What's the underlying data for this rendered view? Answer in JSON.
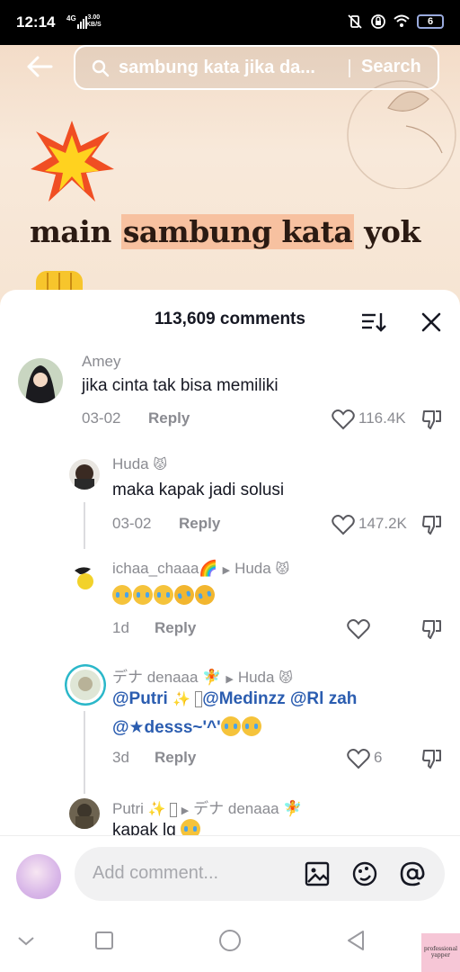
{
  "status_bar": {
    "time": "12:14",
    "network": "4G",
    "speed_value": "3.00",
    "speed_unit": "KB/S",
    "battery": "6"
  },
  "search": {
    "query": "sambung kata jika da...",
    "button": "Search"
  },
  "video": {
    "caption_before": "main ",
    "caption_highlight": "sambung kata",
    "caption_after": " yok"
  },
  "comments_header": {
    "count_label": "113,609 comments"
  },
  "comments": [
    {
      "author": "Amey",
      "text": "jika cinta tak bisa memiliki",
      "date": "03-02",
      "reply": "Reply",
      "likes": "116.4K"
    },
    {
      "author": "Huda",
      "text": "maka kapak jadi solusi",
      "date": "03-02",
      "reply": "Reply",
      "likes": "147.2K"
    },
    {
      "author": "ichaa_chaaa",
      "reply_to": "Huda",
      "date": "1d",
      "reply": "Reply",
      "likes": ""
    },
    {
      "author": "デナ denaaa",
      "reply_to": "Huda",
      "mention1": "@Putri",
      "mention2": "@Medinzz",
      "mention3": "@Rl zah",
      "mention4": "@★desss~'^'",
      "date": "3d",
      "reply": "Reply",
      "likes": "6"
    },
    {
      "author": "Putri",
      "reply_to": "デナ denaaa",
      "text": "kapak lg"
    }
  ],
  "composer": {
    "placeholder": "Add comment..."
  },
  "watermark": {
    "line1": "professional",
    "line2": "yapper"
  },
  "colors": {
    "mention": "#2b5db0",
    "highlight": "#f7c1a0",
    "secondary_text": "#8a8b91"
  }
}
